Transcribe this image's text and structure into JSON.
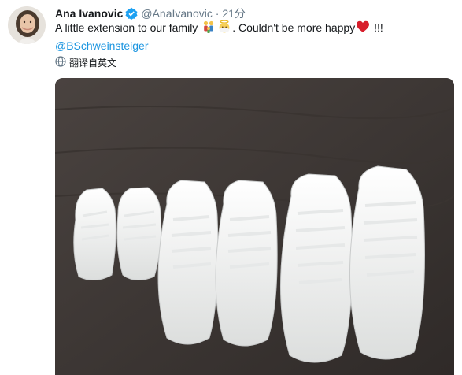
{
  "tweet": {
    "author_name": "Ana Ivanovic",
    "handle": "@AnaIvanovic",
    "separator": "·",
    "timestamp": "21分",
    "verified": true,
    "text_part1": "A little extension to our family",
    "text_part2": ". Couldn't be more happy",
    "text_part3": " !!!",
    "emojis": [
      "family-emoji",
      "baby-angel-emoji",
      "red-heart-emoji"
    ],
    "mention": "@BSchweinsteiger",
    "translate_label": "翻译自英文",
    "colors": {
      "link": "#1b95e0",
      "secondary": "#657786",
      "verified": "#1da1f2",
      "heart": "#e0245e"
    }
  },
  "photo": {
    "subject": "shoes-photo",
    "contents": [
      "baby-sneakers",
      "women-sneakers",
      "men-sneakers"
    ]
  }
}
